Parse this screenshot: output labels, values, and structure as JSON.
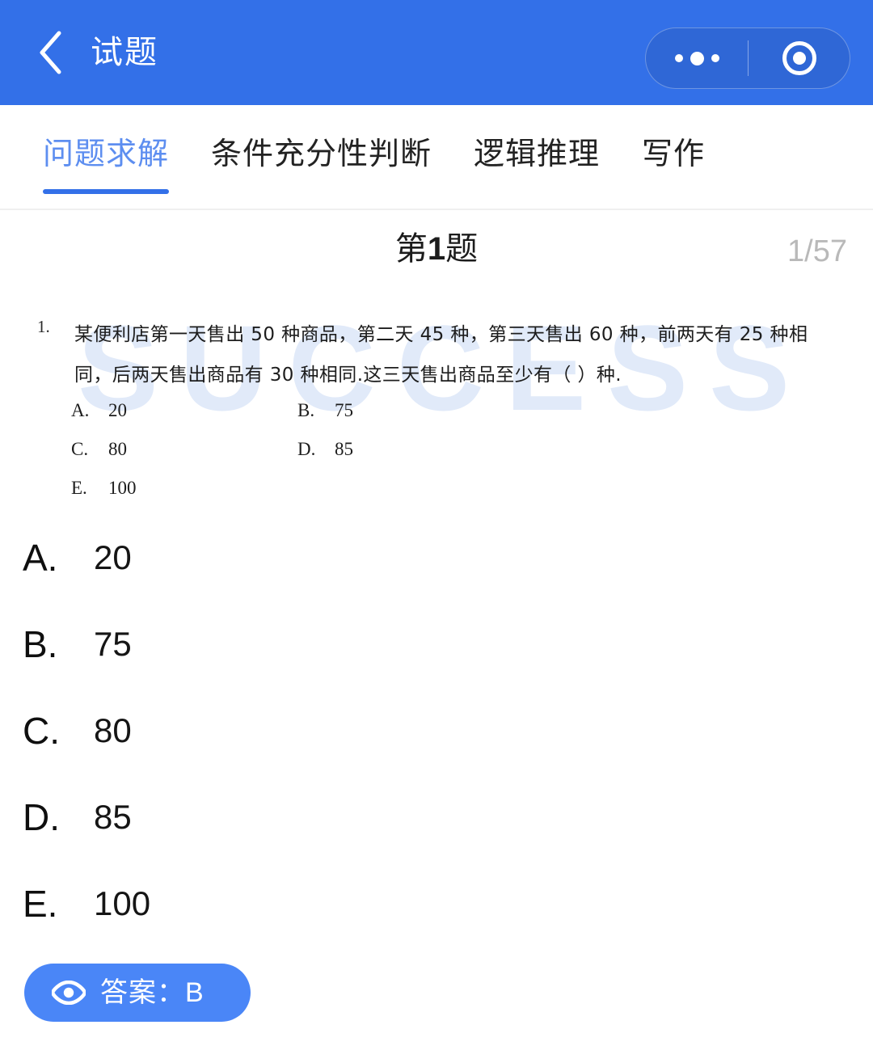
{
  "header": {
    "title": "试题",
    "back_icon": "chevron-left-icon",
    "capsule": {
      "more_icon": "more-dots-icon",
      "target_icon": "target-circle-icon"
    },
    "background_color": "#3370e8"
  },
  "tabs": [
    {
      "label": "问题求解",
      "active": true
    },
    {
      "label": "条件充分性判断",
      "active": false
    },
    {
      "label": "逻辑推理",
      "active": false
    },
    {
      "label": "写作",
      "active": false
    }
  ],
  "question_header": {
    "prefix": "第",
    "number": "1",
    "suffix": "题",
    "counter": "1/57"
  },
  "question_image": {
    "watermark": "SUCCESS",
    "number": "1.",
    "text": "某便利店第一天售出 50 种商品，第二天 45 种，第三天售出 60 种，前两天有 25 种相同，后两天售出商品有 30 种相同.这三天售出商品至少有（    ）种.",
    "options": [
      {
        "label": "A.",
        "value": "20"
      },
      {
        "label": "B.",
        "value": "75"
      },
      {
        "label": "C.",
        "value": "80"
      },
      {
        "label": "D.",
        "value": "85"
      },
      {
        "label": "E.",
        "value": "100"
      }
    ]
  },
  "options": [
    {
      "label": "A.",
      "value": "20"
    },
    {
      "label": "B.",
      "value": "75"
    },
    {
      "label": "C.",
      "value": "80"
    },
    {
      "label": "D.",
      "value": "85"
    },
    {
      "label": "E.",
      "value": "100"
    }
  ],
  "answer_button": {
    "icon": "eye-icon",
    "label": "答案：B",
    "color": "#4a86f7"
  },
  "colors": {
    "primary": "#3370e8",
    "accent": "#4a86f7",
    "active_tab_text": "#5d8ef0",
    "watermark": "#e1eaf9",
    "counter_text": "#b9b9b9"
  }
}
